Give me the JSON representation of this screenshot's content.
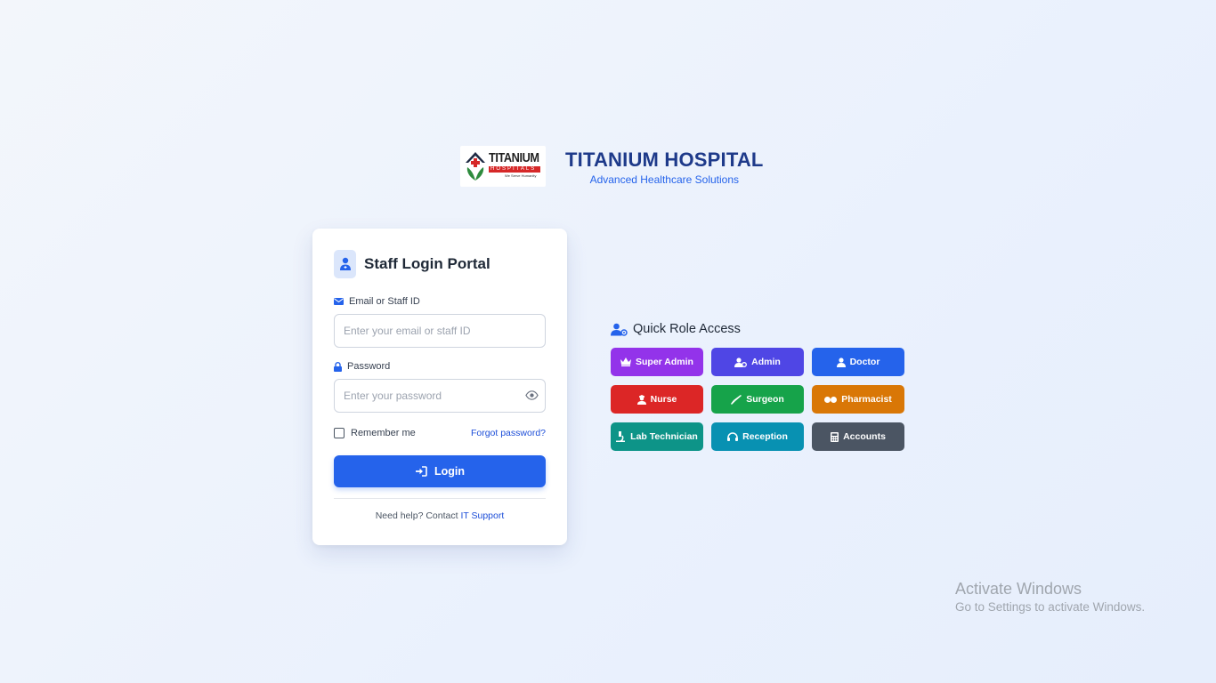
{
  "brand": {
    "logo_title": "TITANIUM",
    "logo_subtitle": "HOSPITALS",
    "logo_tagline": "We Serve Humanity",
    "title": "TITANIUM HOSPITAL",
    "subtitle": "Advanced Healthcare Solutions"
  },
  "login": {
    "title": "Staff Login Portal",
    "email_label": "Email or Staff ID",
    "email_value": "",
    "email_placeholder": "Enter your email or staff ID",
    "password_label": "Password",
    "password_value": "",
    "password_placeholder": "Enter your password",
    "remember_label": "Remember me",
    "remember_checked": false,
    "forgot_label": "Forgot password?",
    "login_label": "Login",
    "help_text": "Need help? Contact ",
    "help_link": "IT Support"
  },
  "quick_access": {
    "title": "Quick Role Access",
    "roles": [
      {
        "label": "Super Admin",
        "icon": "crown-icon",
        "color": "#9333ea"
      },
      {
        "label": "Admin",
        "icon": "user-gear-icon",
        "color": "#4f46e5"
      },
      {
        "label": "Doctor",
        "icon": "user-doctor-icon",
        "color": "#2563eb"
      },
      {
        "label": "Nurse",
        "icon": "user-nurse-icon",
        "color": "#dc2626"
      },
      {
        "label": "Surgeon",
        "icon": "scalpel-icon",
        "color": "#16a34a"
      },
      {
        "label": "Pharmacist",
        "icon": "pills-icon",
        "color": "#d97706"
      },
      {
        "label": "Lab Technician",
        "icon": "microscope-icon",
        "color": "#0d9488"
      },
      {
        "label": "Reception",
        "icon": "headset-icon",
        "color": "#0891b2"
      },
      {
        "label": "Accounts",
        "icon": "calculator-icon",
        "color": "#4b5563"
      }
    ]
  },
  "watermark": {
    "title": "Activate Windows",
    "subtitle": "Go to Settings to activate Windows."
  }
}
